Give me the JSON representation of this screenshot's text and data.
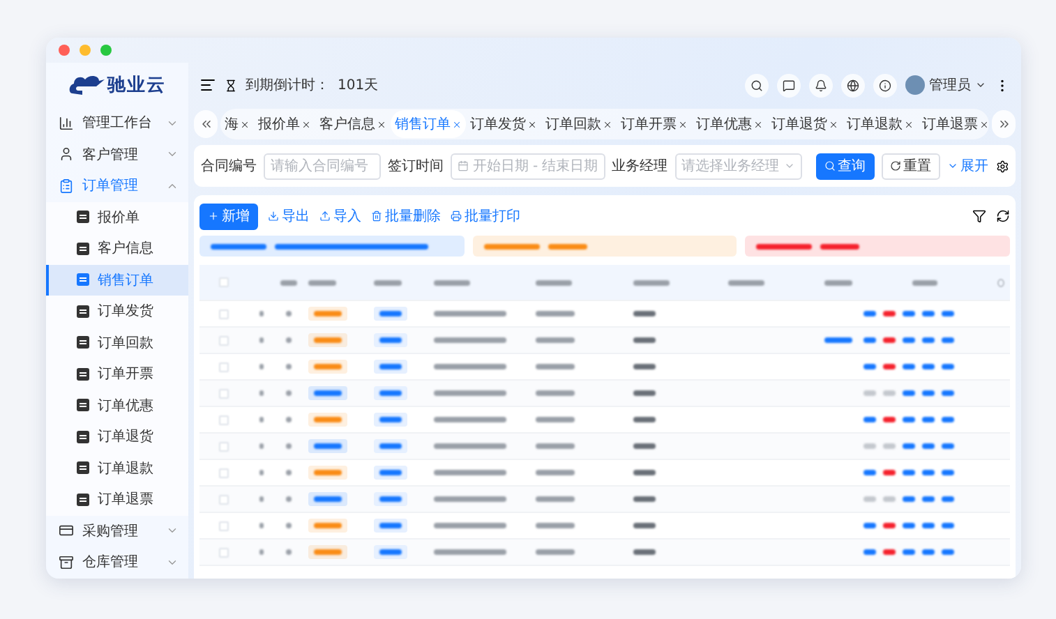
{
  "logo": {
    "text": "驰业云"
  },
  "sidebar": {
    "items": [
      {
        "label": "管理工作台",
        "kind": "dashboard",
        "selected": false,
        "expanded": false
      },
      {
        "label": "客户管理",
        "kind": "customer",
        "selected": false,
        "expanded": false
      },
      {
        "label": "订单管理",
        "kind": "order",
        "selected": true,
        "expanded": true,
        "children": [
          {
            "label": "报价单",
            "selected": false
          },
          {
            "label": "客户信息",
            "selected": false
          },
          {
            "label": "销售订单",
            "selected": true
          },
          {
            "label": "订单发货",
            "selected": false
          },
          {
            "label": "订单回款",
            "selected": false
          },
          {
            "label": "订单开票",
            "selected": false
          },
          {
            "label": "订单优惠",
            "selected": false
          },
          {
            "label": "订单退货",
            "selected": false
          },
          {
            "label": "订单退款",
            "selected": false
          },
          {
            "label": "订单退票",
            "selected": false
          }
        ]
      },
      {
        "label": "采购管理",
        "kind": "purchase",
        "selected": false,
        "expanded": false
      },
      {
        "label": "仓库管理",
        "kind": "warehouse",
        "selected": false,
        "expanded": false
      }
    ]
  },
  "topbar": {
    "countdown_label": "到期倒计时：",
    "countdown_value": "101天",
    "user": "管理员"
  },
  "tabs": [
    {
      "label": "海",
      "selected": false
    },
    {
      "label": "报价单",
      "selected": false
    },
    {
      "label": "客户信息",
      "selected": false
    },
    {
      "label": "销售订单",
      "selected": true
    },
    {
      "label": "订单发货",
      "selected": false
    },
    {
      "label": "订单回款",
      "selected": false
    },
    {
      "label": "订单开票",
      "selected": false
    },
    {
      "label": "订单优惠",
      "selected": false
    },
    {
      "label": "订单退货",
      "selected": false
    },
    {
      "label": "订单退款",
      "selected": false
    },
    {
      "label": "订单退票",
      "selected": false
    }
  ],
  "filters": {
    "contract_label": "合同编号",
    "contract_placeholder": "请输入合同编号",
    "date_label": "签订时间",
    "start_placeholder": "开始日期",
    "separator": "-",
    "end_placeholder": "结束日期",
    "manager_label": "业务经理",
    "manager_placeholder": "请选择业务经理",
    "search_button": "查询",
    "reset_button": "重置",
    "expand_link": "展开"
  },
  "toolbar": {
    "add_button": "新增",
    "actions": [
      {
        "label": "导出",
        "kind": "export"
      },
      {
        "label": "导入",
        "kind": "import"
      },
      {
        "label": "批量删除",
        "kind": "delete"
      },
      {
        "label": "批量打印",
        "kind": "print"
      }
    ]
  },
  "summary": [
    {
      "color": "#1677ff"
    },
    {
      "color": "#fa8c16"
    },
    {
      "color": "#f5222d"
    }
  ],
  "table": {
    "header_checked": false,
    "rows": [
      {
        "color": "#fa8c16",
        "checked": false,
        "actions_disabled": false,
        "has_link": false
      },
      {
        "color": "#fa8c16",
        "checked": false,
        "actions_disabled": false,
        "has_link": true
      },
      {
        "color": "#fa8c16",
        "checked": false,
        "actions_disabled": false,
        "has_link": false
      },
      {
        "color": "#1677ff",
        "checked": false,
        "actions_disabled": true,
        "has_link": false
      },
      {
        "color": "#fa8c16",
        "checked": false,
        "actions_disabled": false,
        "has_link": false
      },
      {
        "color": "#1677ff",
        "checked": false,
        "actions_disabled": true,
        "has_link": false
      },
      {
        "color": "#fa8c16",
        "checked": false,
        "actions_disabled": false,
        "has_link": false
      },
      {
        "color": "#1677ff",
        "checked": false,
        "actions_disabled": true,
        "has_link": false
      },
      {
        "color": "#fa8c16",
        "checked": false,
        "actions_disabled": false,
        "has_link": false
      },
      {
        "color": "#fa8c16",
        "checked": false,
        "actions_disabled": false,
        "has_link": false
      }
    ]
  }
}
